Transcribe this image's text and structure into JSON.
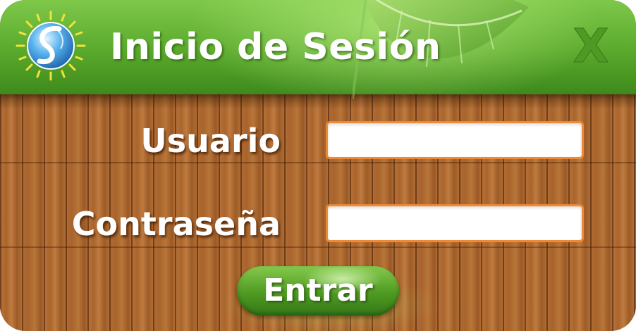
{
  "window": {
    "title": "Inicio de Sesión",
    "close_label": "X"
  },
  "form": {
    "username_label": "Usuario",
    "username_value": "",
    "password_label": "Contraseña",
    "password_value": "",
    "submit_label": "Entrar"
  },
  "colors": {
    "header_green": "#5aa92c",
    "wood_brown": "#a8652d",
    "field_border_orange": "#ef8a34",
    "close_green": "#4e9a24",
    "text_white": "#ffffff"
  },
  "icons": {
    "logo": "sun-globe-logo-icon",
    "close": "close-x-icon",
    "decoration": "green-leaf-icon"
  }
}
